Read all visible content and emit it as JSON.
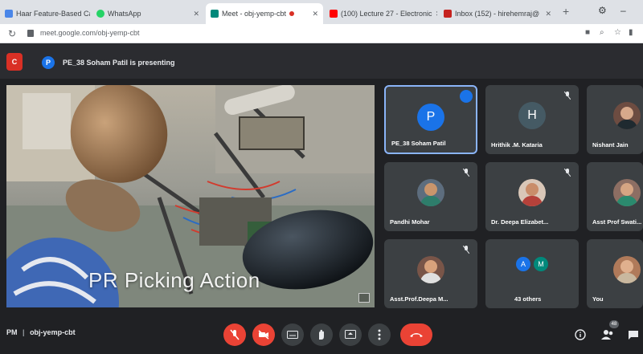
{
  "browser": {
    "tabs": [
      {
        "title": "Haar Feature-Based Cascade Classifier for Object Detect",
        "color": "#4a86e8"
      },
      {
        "title": "WhatsApp",
        "color": "#25d366"
      },
      {
        "title": "Meet - obj-yemp-cbt",
        "color": "#00897b"
      },
      {
        "title": "(100) Lecture 27 - Electronic",
        "color": "#ff0000"
      },
      {
        "title": "Inbox (152) - hirehemraj@",
        "color": "#c5221f"
      }
    ],
    "url": "meet.google.com/obj-yemp-cbt"
  },
  "meet": {
    "logo_text": "C",
    "presenter_initial": "P",
    "presenting_text": "PE_38 Soham Patil is presenting",
    "stage_caption": "PR Picking Action",
    "participants": [
      {
        "name": "PE_38 Soham Patil",
        "initial": "P",
        "type": "initial",
        "color": "#1a73e8",
        "speaking": true
      },
      {
        "name": "Hrithik .M. Kataria",
        "initial": "H",
        "type": "initial",
        "color": "#455a64",
        "speaking": false
      },
      {
        "name": "Nishant Jain",
        "initial": "",
        "type": "photo",
        "color": "#6d4c41",
        "speaking": false
      },
      {
        "name": "Pandhi Mohar",
        "initial": "",
        "type": "photo",
        "color": "#5d6d7e",
        "speaking": false
      },
      {
        "name": "Dr. Deepa Elizabet...",
        "initial": "",
        "type": "photo",
        "color": "#a0522d",
        "speaking": false
      },
      {
        "name": "Asst Prof Swati...",
        "initial": "",
        "type": "photo",
        "color": "#8d6e63",
        "speaking": false
      },
      {
        "name": "Asst.Prof.Deepa M...",
        "initial": "",
        "type": "photo",
        "color": "#795548",
        "speaking": false
      },
      {
        "name": "43 others",
        "initial": "",
        "type": "others",
        "color": "#3c4043",
        "speaking": false
      },
      {
        "name": "You",
        "initial": "",
        "type": "photo",
        "color": "#b07a5a",
        "speaking": false
      }
    ],
    "others_avatars": [
      {
        "initial": "A",
        "color": "#1a73e8"
      },
      {
        "initial": "M",
        "color": "#00897b"
      }
    ],
    "meeting_time": "PM",
    "meeting_code": "obj-yemp-cbt",
    "people_count": "48"
  }
}
